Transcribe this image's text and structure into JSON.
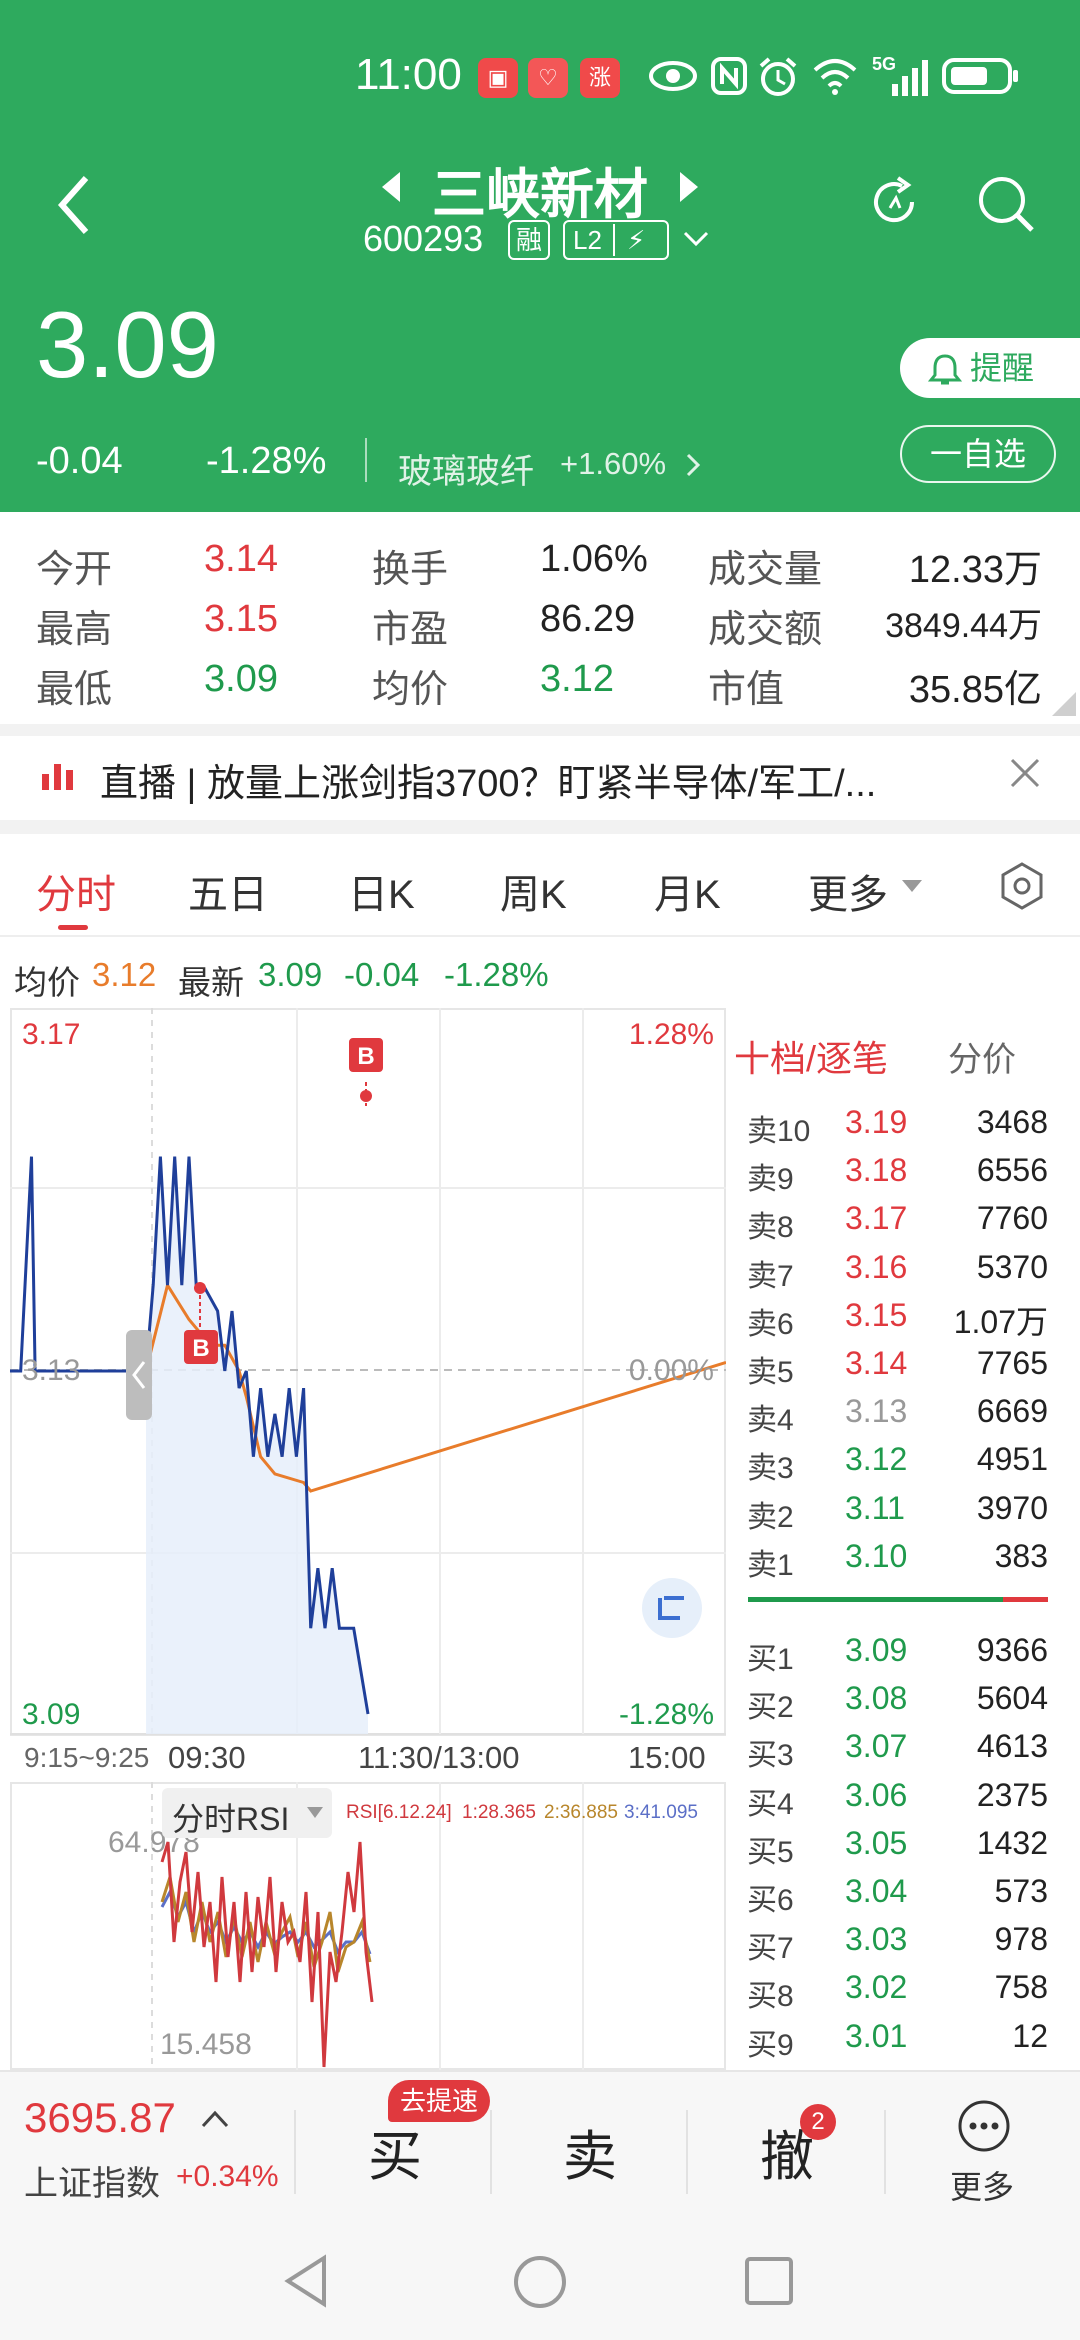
{
  "status_bar": {
    "time": "11:00",
    "network": "5G"
  },
  "header": {
    "stock_name": "三峡新材",
    "stock_code": "600293",
    "badges": [
      "融",
      "L2"
    ],
    "price": "3.09",
    "change_abs": "-0.04",
    "change_pct": "-1.28%",
    "sector_name": "玻璃玻纤",
    "sector_change": "+1.60%",
    "remind_label": "提醒",
    "watchlist_label": "一自选"
  },
  "stats": [
    {
      "label": "今开",
      "value": "3.14",
      "color": "red"
    },
    {
      "label": "换手",
      "value": "1.06%",
      "color": "black"
    },
    {
      "label": "成交量",
      "value": "12.33万",
      "color": "black"
    },
    {
      "label": "最高",
      "value": "3.15",
      "color": "red"
    },
    {
      "label": "市盈",
      "value": "86.29",
      "color": "black"
    },
    {
      "label": "成交额",
      "value": "3849.44万",
      "color": "black"
    },
    {
      "label": "最低",
      "value": "3.09",
      "color": "green"
    },
    {
      "label": "均价",
      "value": "3.12",
      "color": "green"
    },
    {
      "label": "市值",
      "value": "35.85亿",
      "color": "black"
    }
  ],
  "news": {
    "text": "直播 | 放量上涨剑指3700？盯紧半导体/军工/..."
  },
  "tabs": [
    "分时",
    "五日",
    "日K",
    "周K",
    "月K",
    "更多"
  ],
  "info_row": {
    "avg_label": "均价",
    "avg_value": "3.12",
    "latest_label": "最新",
    "latest_value": "3.09",
    "change_abs": "-0.04",
    "change_pct": "-1.28%"
  },
  "chart_labels": {
    "y_top": "3.17",
    "y_mid": "3.13",
    "y_bottom": "3.09",
    "pct_top": "1.28%",
    "pct_mid": "0.00%",
    "pct_bottom": "-1.28%",
    "x_ticks": [
      "9:15~9:25",
      "09:30",
      "11:30/13:00",
      "15:00"
    ],
    "marker": "B"
  },
  "chart_data": {
    "type": "line",
    "title": "",
    "ylim": [
      3.09,
      3.17
    ],
    "reference_price": 3.13,
    "x_ticks": [
      "9:15~9:25",
      "09:30",
      "11:30/13:00",
      "15:00"
    ],
    "series": [
      {
        "name": "最新",
        "color": "#1f3f9a",
        "points": [
          [
            0,
            3.13
          ],
          [
            0.015,
            3.13
          ],
          [
            0.03,
            3.155
          ],
          [
            0.035,
            3.13
          ],
          [
            0.19,
            3.13
          ],
          [
            0.2,
            3.14
          ],
          [
            0.21,
            3.155
          ],
          [
            0.22,
            3.14
          ],
          [
            0.23,
            3.155
          ],
          [
            0.24,
            3.14
          ],
          [
            0.25,
            3.155
          ],
          [
            0.26,
            3.14
          ],
          [
            0.27,
            3.14
          ],
          [
            0.29,
            3.137
          ],
          [
            0.3,
            3.13
          ],
          [
            0.31,
            3.137
          ],
          [
            0.32,
            3.128
          ],
          [
            0.33,
            3.13
          ],
          [
            0.34,
            3.12
          ],
          [
            0.35,
            3.128
          ],
          [
            0.36,
            3.12
          ],
          [
            0.37,
            3.125
          ],
          [
            0.38,
            3.12
          ],
          [
            0.39,
            3.128
          ],
          [
            0.4,
            3.12
          ],
          [
            0.41,
            3.128
          ],
          [
            0.42,
            3.1
          ],
          [
            0.43,
            3.107
          ],
          [
            0.44,
            3.1
          ],
          [
            0.45,
            3.107
          ],
          [
            0.46,
            3.1
          ],
          [
            0.48,
            3.1
          ],
          [
            0.5,
            3.09
          ]
        ]
      },
      {
        "name": "均价",
        "color": "#e87c2b",
        "points": [
          [
            0.19,
            3.13
          ],
          [
            0.22,
            3.14
          ],
          [
            0.25,
            3.136
          ],
          [
            0.28,
            3.133
          ],
          [
            0.3,
            3.133
          ],
          [
            0.32,
            3.13
          ],
          [
            0.33,
            3.127
          ],
          [
            0.35,
            3.12
          ],
          [
            0.37,
            3.118
          ],
          [
            0.41,
            3.117
          ],
          [
            0.42,
            3.116
          ],
          [
            1.0,
            3.131
          ]
        ]
      }
    ]
  },
  "rsi": {
    "label": "分时RSI",
    "params": "RSI[6.12.24]",
    "values": [
      {
        "text": "1:28.365",
        "color": "#d0393e"
      },
      {
        "text": "2:36.885",
        "color": "#b8862b"
      },
      {
        "text": "3:41.095",
        "color": "#5b6fc7"
      }
    ],
    "top": "64.978",
    "bottom": "15.458"
  },
  "order_book": {
    "title": "十档/逐笔",
    "subtitle": "分价",
    "sells": [
      {
        "label": "卖10",
        "price": "3.19",
        "vol": "3468",
        "color": "red"
      },
      {
        "label": "卖9",
        "price": "3.18",
        "vol": "6556",
        "color": "red"
      },
      {
        "label": "卖8",
        "price": "3.17",
        "vol": "7760",
        "color": "red"
      },
      {
        "label": "卖7",
        "price": "3.16",
        "vol": "5370",
        "color": "red"
      },
      {
        "label": "卖6",
        "price": "3.15",
        "vol": "1.07万",
        "color": "red"
      },
      {
        "label": "卖5",
        "price": "3.14",
        "vol": "7765",
        "color": "red"
      },
      {
        "label": "卖4",
        "price": "3.13",
        "vol": "6669",
        "color": "grey"
      },
      {
        "label": "卖3",
        "price": "3.12",
        "vol": "4951",
        "color": "green"
      },
      {
        "label": "卖2",
        "price": "3.11",
        "vol": "3970",
        "color": "green"
      },
      {
        "label": "卖1",
        "price": "3.10",
        "vol": "383",
        "color": "green"
      }
    ],
    "buys": [
      {
        "label": "买1",
        "price": "3.09",
        "vol": "9366",
        "color": "green"
      },
      {
        "label": "买2",
        "price": "3.08",
        "vol": "5604",
        "color": "green"
      },
      {
        "label": "买3",
        "price": "3.07",
        "vol": "4613",
        "color": "green"
      },
      {
        "label": "买4",
        "price": "3.06",
        "vol": "2375",
        "color": "green"
      },
      {
        "label": "买5",
        "price": "3.05",
        "vol": "1432",
        "color": "green"
      },
      {
        "label": "买6",
        "price": "3.04",
        "vol": "573",
        "color": "green"
      },
      {
        "label": "买7",
        "price": "3.03",
        "vol": "978",
        "color": "green"
      },
      {
        "label": "买8",
        "price": "3.02",
        "vol": "758",
        "color": "green"
      },
      {
        "label": "买9",
        "price": "3.01",
        "vol": "12",
        "color": "green"
      }
    ],
    "buy_ratio": 0.85
  },
  "bottom_bar": {
    "index_value": "3695.87",
    "index_name": "上证指数",
    "index_change": "+0.34%",
    "buy_label": "买",
    "buy_badge": "去提速",
    "sell_label": "卖",
    "cancel_label": "撤",
    "cancel_count": "2",
    "more_label": "更多"
  },
  "colors": {
    "header_green": "#2eaa5e",
    "up_red": "#e0393e",
    "down_green": "#1f9a4c",
    "price_line": "#1f3f9a",
    "avg_line": "#e87c2b"
  }
}
